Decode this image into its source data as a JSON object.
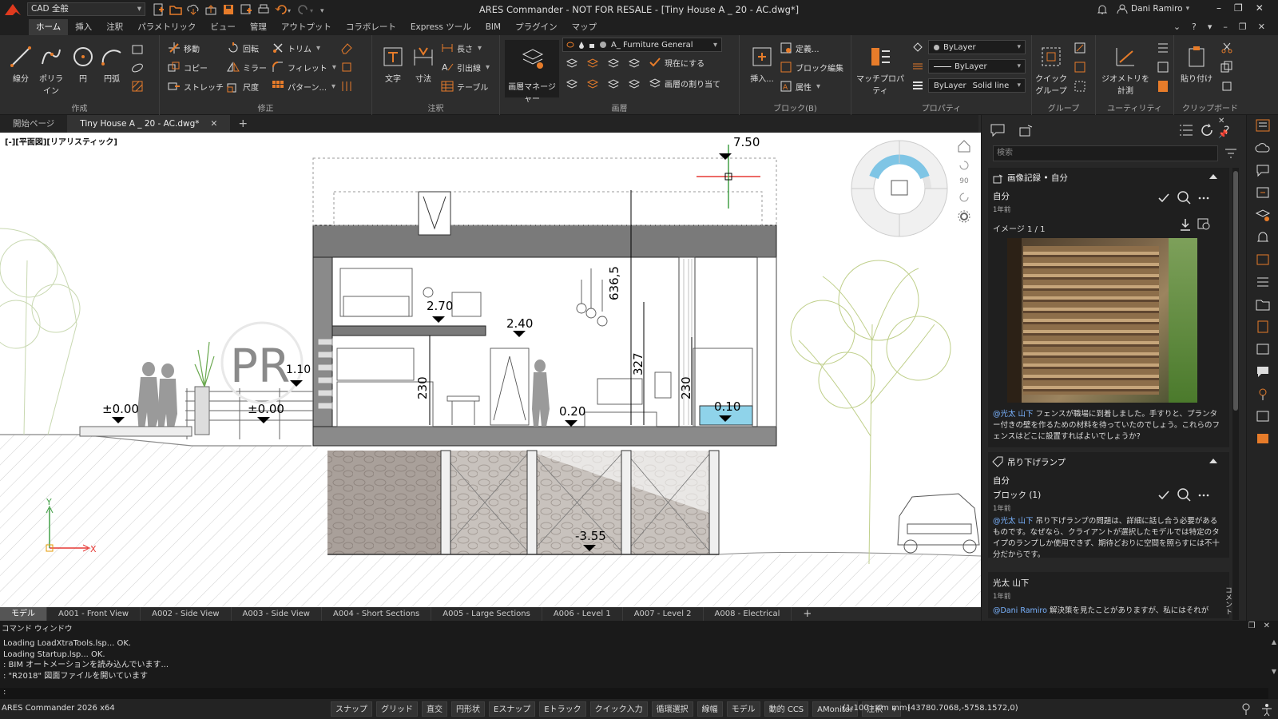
{
  "app": {
    "workspace": "CAD 全般",
    "window_title": "ARES Commander - NOT FOR RESALE - [Tiny House A _ 20 - AC.dwg*]",
    "user_name": "Dani Ramiro",
    "accent_color": "#e03a1e"
  },
  "ribbon_tabs": [
    "ホーム",
    "挿入",
    "注釈",
    "パラメトリック",
    "ビュー",
    "管理",
    "アウトプット",
    "コラボレート",
    "Express ツール",
    "BIM",
    "プラグイン",
    "マップ"
  ],
  "ribbon": {
    "draw": {
      "label": "作成",
      "line": "線分",
      "polyline": "ポリライン",
      "circle": "円",
      "arc": "円弧"
    },
    "modify": {
      "label": "修正",
      "move": "移動",
      "rotate": "回転",
      "trim": "トリム",
      "copy": "コピー",
      "mirror": "ミラー",
      "fillet": "フィレット",
      "stretch": "ストレッチ",
      "scale": "尺度",
      "pattern": "パターン..."
    },
    "annotate": {
      "label": "注釈",
      "text": "文字",
      "dimension": "寸法",
      "length": "長さ",
      "leader": "引出線",
      "table": "テーブル"
    },
    "layers": {
      "label": "画層",
      "manager": "画層マネージャー",
      "current_layer": "A_ Furniture General",
      "set_current": "現在にする",
      "assign": "画層の割り当て"
    },
    "block": {
      "label": "ブロック(B)",
      "insert": "挿入...",
      "define": "定義...",
      "edit": "ブロック編集",
      "attribute": "属性"
    },
    "properties": {
      "label": "プロパティ",
      "match": "マッチプロパティ",
      "color": "ByLayer",
      "linetype": "ByLayer",
      "lineweight_label": "ByLayer",
      "lineweight_value": "Solid line"
    },
    "groups": {
      "label": "グループ",
      "quick_group": "クイック グループ"
    },
    "utilities": {
      "label": "ユーティリティ",
      "measure": "ジオメトリを計測"
    },
    "clipboard": {
      "label": "クリップボード",
      "paste": "貼り付け"
    }
  },
  "doc_tabs": [
    "開始ページ",
    "Tiny House A _ 20 - AC.dwg*"
  ],
  "viewport": {
    "label": "[-][平面図][リアリスティック]",
    "elevations": [
      "7.50",
      "2.70",
      "2.40",
      "1.10",
      "±0.00",
      "±0.00",
      "0.20",
      "0.10",
      "-3.55"
    ],
    "dimensions": [
      "636,5",
      "327",
      "230",
      "230"
    ],
    "stamp": "PR",
    "nav_zoom": "90"
  },
  "layout_tabs": [
    "モデル",
    "A001 - Front View",
    "A002 - Side View",
    "A003 - Side View",
    "A004 - Short Sections",
    "A005 - Large Sections",
    "A006 - Level 1",
    "A007 - Level 2",
    "A008 - Electrical"
  ],
  "panel": {
    "search_placeholder": "検索",
    "comment1": {
      "title": "画像記録 • 自分",
      "author": "自分",
      "time": "1年前",
      "image_counter": "イメージ 1 / 1",
      "mention": "@光太 山下",
      "text": " フェンスが職場に到着しました。手すりと、プランター付きの壁を作るための材料を待っていたのでしょう。これらのフェンスはどこに設置すればよいでしょうか?"
    },
    "comment2": {
      "title": "吊り下げランプ",
      "author": "自分",
      "block": "ブロック (1)",
      "time": "1年前",
      "mention": "@光太 山下",
      "text": " 吊り下げランプの問題は、詳細に話し合う必要があるものです。なぜなら、クライアントが選択したモデルでは特定のタイプのランプしか使用できず、期待どおりに空間を照らすには不十分だからです。"
    },
    "comment3": {
      "author": "光太 山下",
      "time": "1年前",
      "mention": "@Dani Ramiro",
      "text": " 解決策を見たことがありますが、私にはそれが"
    },
    "side_label": "コメント"
  },
  "command_window": {
    "title": "コマンド ウィンドウ",
    "lines": [
      "Loading LoadXtraTools.lsp...  OK.",
      "Loading Startup.lsp...  OK.",
      ": BIM オートメーションを読み込んでいます...",
      ": \"R2018\" 図面ファイルを開いています"
    ],
    "prompt": ":"
  },
  "status": {
    "version": "ARES Commander 2026 x64",
    "buttons": [
      "スナップ",
      "グリッド",
      "直交",
      "円形状",
      "Eスナップ",
      "Eトラック",
      "クイック入力",
      "循環選択",
      "線幅",
      "モデル",
      "動的 CCS",
      "AMonitor",
      "注釈"
    ],
    "scale": "(1:100 - cm mm)",
    "coords": "(43780.7068,-5758.1572,0)"
  }
}
